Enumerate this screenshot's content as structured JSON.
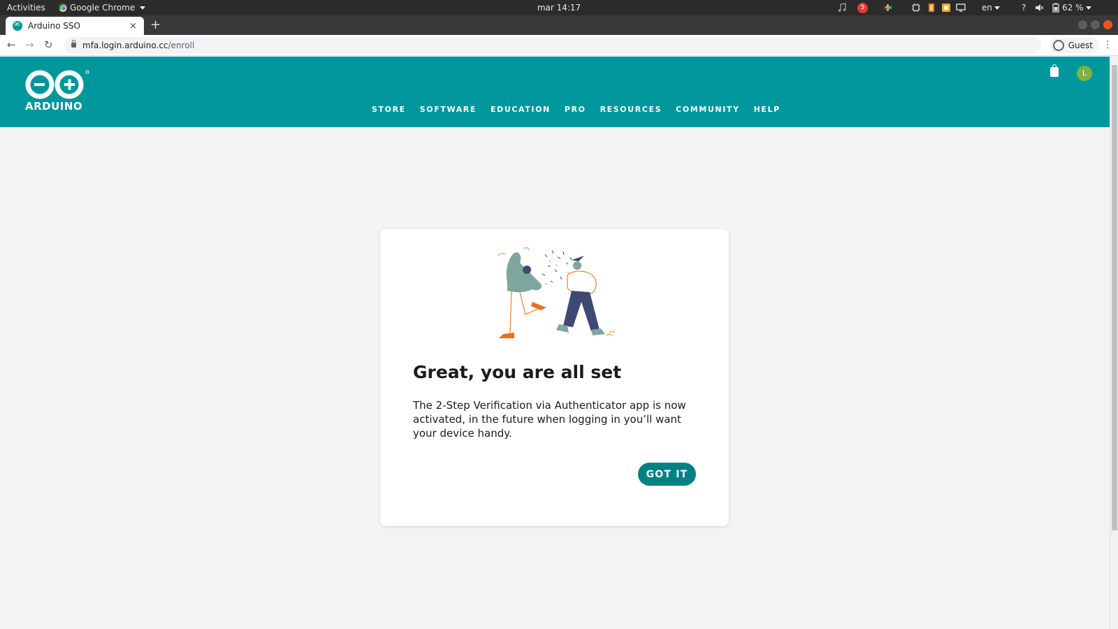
{
  "system_bar": {
    "activities": "Activities",
    "app_name": "Google Chrome",
    "clock": "mar 14:17",
    "notification_count": "5",
    "language": "en",
    "help": "?",
    "battery": "62 %"
  },
  "browser": {
    "tab_title": "Arduino SSO",
    "tab_close": "×",
    "new_tab": "+",
    "url_host": "mfa.login.arduino.cc",
    "url_path": "/enroll",
    "profile_label": "Guest",
    "menu": "⋮",
    "back": "←",
    "forward": "→",
    "reload": "↻"
  },
  "header": {
    "brand": "ARDUINO",
    "nav": [
      "STORE",
      "SOFTWARE",
      "EDUCATION",
      "PRO",
      "RESOURCES",
      "COMMUNITY",
      "HELP"
    ],
    "user_initial": "L",
    "colors": {
      "brand": "#00979c",
      "avatar": "#7cb342"
    }
  },
  "card": {
    "title": "Great, you are all set",
    "body": "The 2-Step Verification via Authenticator app is now activated, in the future when logging in you’ll want your device handy.",
    "button_label": "GOT IT",
    "button_color": "#008184"
  }
}
